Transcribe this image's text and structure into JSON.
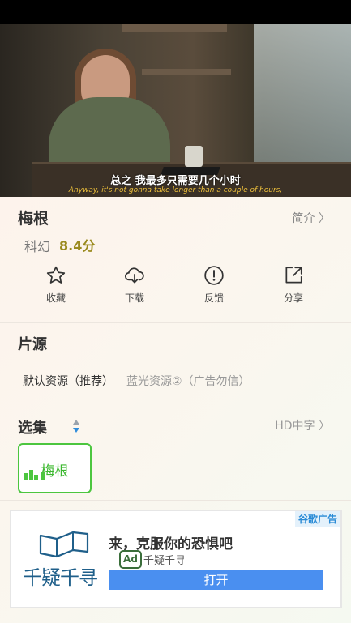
{
  "video": {
    "subtitle_cn": "总之 我最多只需要几个小时",
    "subtitle_en": "Anyway, it's not gonna take longer than a couple of hours,"
  },
  "movie": {
    "title": "梅根",
    "intro_label": "简介 〉",
    "genre": "科幻",
    "score": "8.4分"
  },
  "actions": [
    {
      "label": "收藏",
      "icon": "star-icon"
    },
    {
      "label": "下载",
      "icon": "cloud-download-icon"
    },
    {
      "label": "反馈",
      "icon": "alert-circle-icon"
    },
    {
      "label": "分享",
      "icon": "share-icon"
    }
  ],
  "sources": {
    "title": "片源",
    "items": [
      "默认资源（推荐）",
      "蓝光资源②（广告勿信）"
    ]
  },
  "episodes": {
    "title": "选集",
    "quality": "HD中字 〉",
    "items": [
      {
        "label": "梅根"
      }
    ]
  },
  "ad": {
    "corner": "谷歌广告",
    "logo_text": "千疑千寻",
    "headline": "来，克服你的恐惧吧",
    "badge": "Ad",
    "brand": "千疑千寻",
    "button": "打开"
  },
  "colors": {
    "accent_green": "#4cc63f",
    "score_color": "#9a8a1e",
    "ad_button": "#4a8ff0"
  }
}
